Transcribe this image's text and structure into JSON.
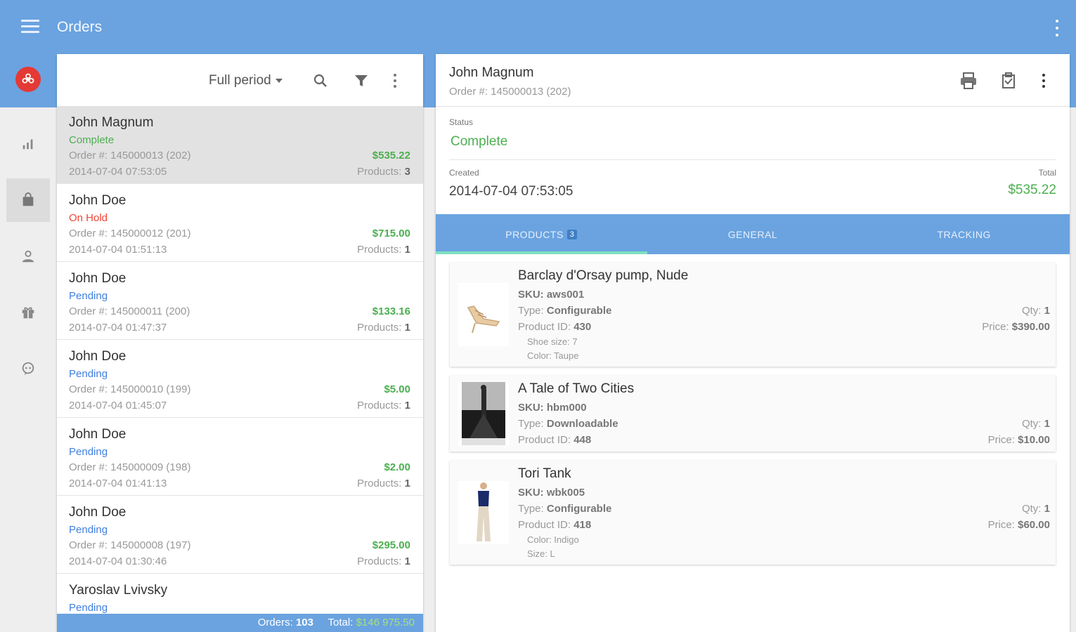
{
  "app": {
    "title": "Orders"
  },
  "colors": {
    "primary": "#6aa3e0",
    "complete": "#4caf50",
    "on_hold": "#f44336",
    "pending": "#3f7fe0"
  },
  "rail": {
    "items": [
      {
        "name": "dashboard",
        "icon": "bar-chart-icon"
      },
      {
        "name": "orders",
        "icon": "shopping-bag-icon",
        "active": true
      },
      {
        "name": "customers",
        "icon": "person-icon"
      },
      {
        "name": "products",
        "icon": "gift-box-icon"
      },
      {
        "name": "support",
        "icon": "chat-bubble-icon"
      }
    ]
  },
  "list": {
    "period_label": "Full period",
    "orders": [
      {
        "name": "John Magnum",
        "status": "Complete",
        "status_type": "complete",
        "order_no": "Order #: 145000013 (202)",
        "date": "2014-07-04 07:53:05",
        "total": "$535.22",
        "products_label": "Products:",
        "products_count": "3"
      },
      {
        "name": "John Doe",
        "status": "On Hold",
        "status_type": "on_hold",
        "order_no": "Order #: 145000012 (201)",
        "date": "2014-07-04 01:51:13",
        "total": "$715.00",
        "products_label": "Products:",
        "products_count": "1"
      },
      {
        "name": "John Doe",
        "status": "Pending",
        "status_type": "pending",
        "order_no": "Order #: 145000011 (200)",
        "date": "2014-07-04 01:47:37",
        "total": "$133.16",
        "products_label": "Products:",
        "products_count": "1"
      },
      {
        "name": "John Doe",
        "status": "Pending",
        "status_type": "pending",
        "order_no": "Order #: 145000010 (199)",
        "date": "2014-07-04 01:45:07",
        "total": "$5.00",
        "products_label": "Products:",
        "products_count": "1"
      },
      {
        "name": "John Doe",
        "status": "Pending",
        "status_type": "pending",
        "order_no": "Order #: 145000009 (198)",
        "date": "2014-07-04 01:41:13",
        "total": "$2.00",
        "products_label": "Products:",
        "products_count": "1"
      },
      {
        "name": "John Doe",
        "status": "Pending",
        "status_type": "pending",
        "order_no": "Order #: 145000008 (197)",
        "date": "2014-07-04 01:30:46",
        "total": "$295.00",
        "products_label": "Products:",
        "products_count": "1"
      },
      {
        "name": "Yaroslav Lvivsky",
        "status": "Pending",
        "status_type": "pending",
        "order_no": "",
        "date": "",
        "total": "",
        "products_label": "",
        "products_count": ""
      }
    ],
    "footer": {
      "orders_label": "Orders:",
      "orders_count": "103",
      "total_label": "Total:",
      "total_value": "$146 975.50"
    }
  },
  "detail": {
    "customer": "John Magnum",
    "order_no": "Order #: 145000013 (202)",
    "status_label": "Status",
    "status_value": "Complete",
    "created_label": "Created",
    "created_value": "2014-07-04 07:53:05",
    "total_label": "Total",
    "total_value": "$535.22",
    "tabs": [
      {
        "label": "PRODUCTS",
        "count": "3",
        "active": true
      },
      {
        "label": "GENERAL"
      },
      {
        "label": "TRACKING"
      }
    ],
    "products": [
      {
        "title": "Barclay d'Orsay pump, Nude",
        "sku_label": "SKU:",
        "sku": "aws001",
        "type_label": "Type:",
        "type": "Configurable",
        "pid_label": "Product ID:",
        "pid": "430",
        "attrs": [
          "Shoe size: 7",
          "Color: Taupe"
        ],
        "qty_label": "Qty:",
        "qty": "1",
        "price_label": "Price:",
        "price": "$390.00",
        "thumb": "shoe"
      },
      {
        "title": "A Tale of Two Cities",
        "sku_label": "SKU:",
        "sku": "hbm000",
        "type_label": "Type:",
        "type": "Downloadable",
        "pid_label": "Product ID:",
        "pid": "448",
        "attrs": [],
        "qty_label": "Qty:",
        "qty": "1",
        "price_label": "Price:",
        "price": "$10.00",
        "thumb": "book"
      },
      {
        "title": "Tori Tank",
        "sku_label": "SKU:",
        "sku": "wbk005",
        "type_label": "Type:",
        "type": "Configurable",
        "pid_label": "Product ID:",
        "pid": "418",
        "attrs": [
          "Color: Indigo",
          "Size: L"
        ],
        "qty_label": "Qty:",
        "qty": "1",
        "price_label": "Price:",
        "price": "$60.00",
        "thumb": "tank"
      }
    ]
  }
}
